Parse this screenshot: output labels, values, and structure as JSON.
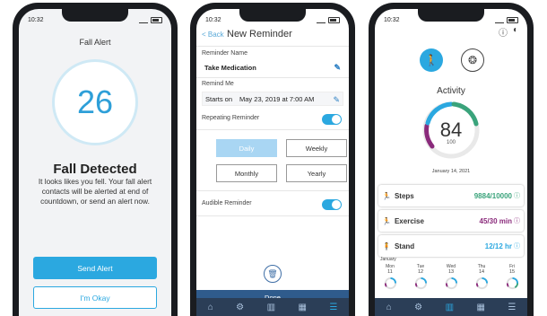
{
  "status_time": "10:32",
  "fall_alert": {
    "title": "Fall Alert",
    "countdown": "26",
    "heading": "Fall Detected",
    "message": "It looks likes you fell. Your fall alert contacts will be alerted at end of countdown, or send an alert now.",
    "send_alert_label": "Send Alert",
    "okay_label": "I'm Okay",
    "accent": "#2ba8e0"
  },
  "reminder": {
    "back_label": "< Back",
    "title": "New Reminder",
    "name_label": "Reminder Name",
    "name_value": "Take Medication",
    "remind_me_label": "Remind Me",
    "starts_on_label": "Starts on",
    "starts_on_value": "May 23, 2019 at 7:00 AM",
    "repeating_label": "Repeating Reminder",
    "repeating_on": true,
    "frequencies": [
      "Daily",
      "Weekly",
      "Monthly",
      "Yearly"
    ],
    "selected_frequency": "Daily",
    "audible_label": "Audible Reminder",
    "audible_on": true,
    "done_label": "Done",
    "tab_icons": [
      "home-icon",
      "sliders-icon",
      "bar-chart-icon",
      "calculator-icon",
      "menu-icon"
    ]
  },
  "activity": {
    "title": "Activity",
    "score": "84",
    "score_max": "100",
    "date": "January 14, 2021",
    "metrics": [
      {
        "name": "Steps",
        "value": "9884/10000",
        "color": "#3aa37b"
      },
      {
        "name": "Exercise",
        "value": "45/30 min",
        "color": "#8a2a7b"
      },
      {
        "name": "Stand",
        "value": "12/12 hr",
        "color": "#2ba8e0"
      }
    ],
    "week_month": "January",
    "week": [
      {
        "day": "Mon",
        "date": "11"
      },
      {
        "day": "Tue",
        "date": "12"
      },
      {
        "day": "Wed",
        "date": "13"
      },
      {
        "day": "Thu",
        "date": "14"
      },
      {
        "day": "Fri",
        "date": "15"
      }
    ]
  }
}
